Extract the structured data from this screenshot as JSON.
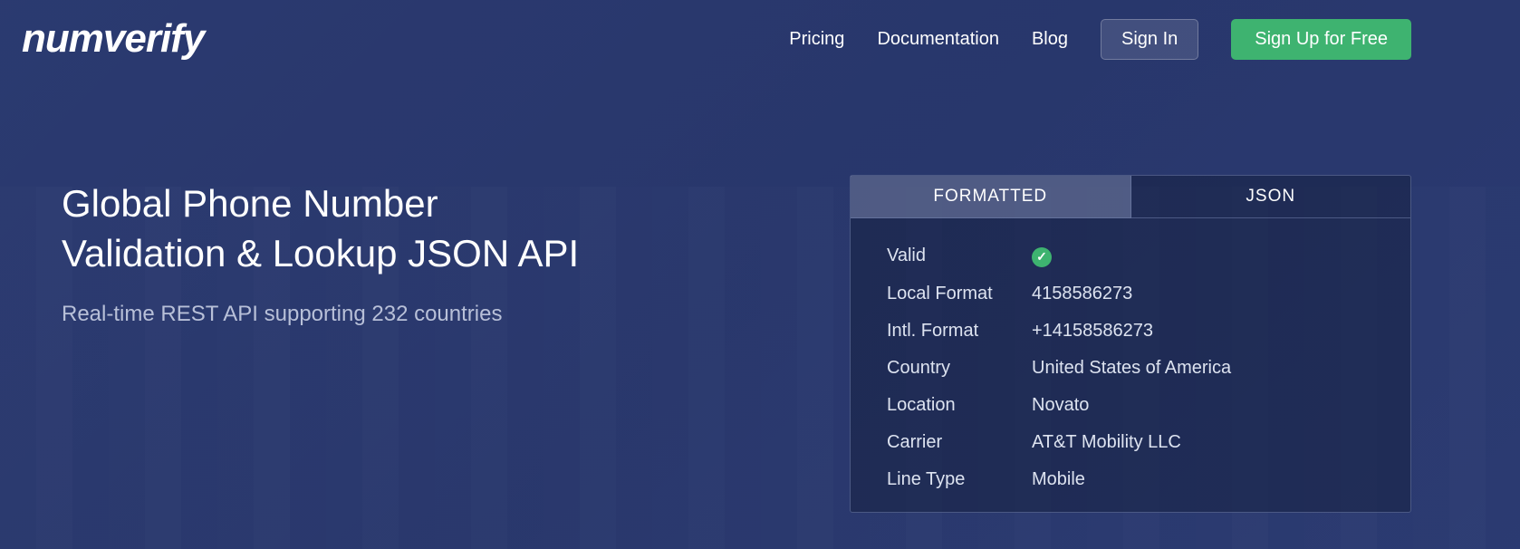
{
  "header": {
    "logo": "numverify",
    "nav": {
      "pricing": "Pricing",
      "documentation": "Documentation",
      "blog": "Blog"
    },
    "buttons": {
      "signin": "Sign In",
      "signup": "Sign Up for Free"
    }
  },
  "hero": {
    "title_line1": "Global Phone Number",
    "title_line2": "Validation & Lookup JSON API",
    "subtitle": "Real-time REST API supporting 232 countries"
  },
  "tabs": {
    "formatted": "FORMATTED",
    "json": "JSON"
  },
  "result": {
    "labels": {
      "valid": "Valid",
      "local_format": "Local Format",
      "intl_format": "Intl. Format",
      "country": "Country",
      "location": "Location",
      "carrier": "Carrier",
      "line_type": "Line Type"
    },
    "values": {
      "local_format": "4158586273",
      "intl_format": "+14158586273",
      "country": "United States of America",
      "location": "Novato",
      "carrier": "AT&T Mobility LLC",
      "line_type": "Mobile"
    }
  }
}
